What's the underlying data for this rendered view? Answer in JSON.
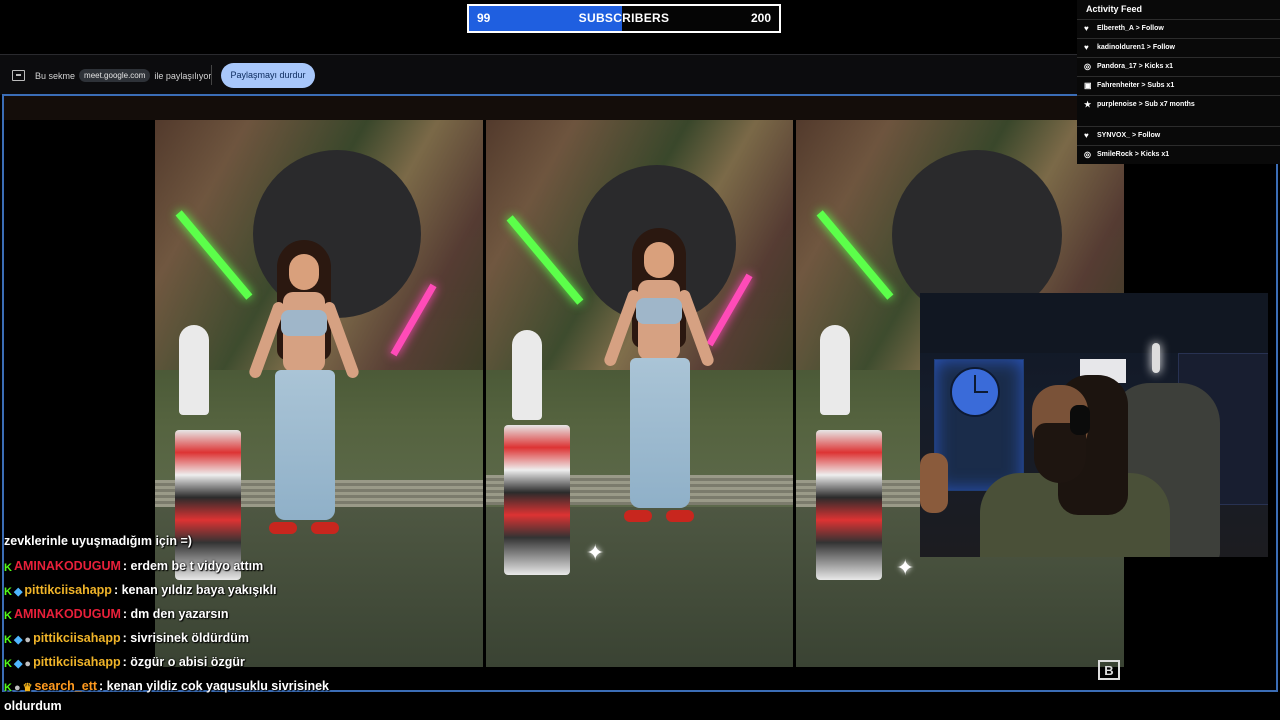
{
  "subscriber_goal": {
    "current": "99",
    "label": "SUBSCRIBERS",
    "target": "200",
    "progress": 0.495,
    "fill_color": "#1f5fe0"
  },
  "share_bar": {
    "prefix": "Bu sekme",
    "domain": "meet.google.com",
    "suffix": "ile paylaşılıyor",
    "stop_button": "Paylaşmayı durdur",
    "icon": "screen-share-icon"
  },
  "activity_feed": {
    "title": "Activity Feed",
    "items": [
      {
        "icon": "heart-icon",
        "text": "Elbereth_A > Follow"
      },
      {
        "icon": "heart-icon",
        "text": "kadinolduren1 > Follow"
      },
      {
        "icon": "kicks-icon",
        "text": "Pandora_17 > Kicks x1"
      },
      {
        "icon": "gift-icon",
        "text": "Fahrenheiter > Subs x1"
      },
      {
        "icon": "star-icon",
        "text": "purplenoise > Sub x7 months"
      },
      {
        "icon": "heart-icon",
        "text": "SYNVOX_ > Follow"
      },
      {
        "icon": "kicks-icon",
        "text": "SmileRock > Kicks x1"
      }
    ]
  },
  "chat": {
    "wrapped_text": "zevklerinle uyuşmadığım için =)",
    "messages": [
      {
        "user": "AMINAKODUGUM",
        "user_color": "#e8203a",
        "text": ": erdem be t vidyo attım",
        "badges": [
          "kick-icon"
        ]
      },
      {
        "user": "pittikciisahapp",
        "user_color": "#f0b429",
        "text": ": kenan yıldız baya yakışıklı",
        "badges": [
          "kick-icon",
          "gem-icon"
        ]
      },
      {
        "user": "AMINAKODUGUM",
        "user_color": "#e8203a",
        "text": ": dm den yazarsın",
        "badges": [
          "kick-icon"
        ]
      },
      {
        "user": "pittikciisahapp",
        "user_color": "#f0b429",
        "text": ": sivrisinek öldürdüm",
        "badges": [
          "kick-icon",
          "gem-icon",
          "coin-icon"
        ]
      },
      {
        "user": "pittikciisahapp",
        "user_color": "#f0b429",
        "text": ": özgür o abisi özgür",
        "badges": [
          "kick-icon",
          "gem-icon",
          "coin-icon"
        ]
      },
      {
        "user": "search_ett",
        "user_color": "#ff9a1f",
        "text": ": kenan yildiz cok yaqusuklu sivrisinek",
        "badges": [
          "kick-icon",
          "coin-icon",
          "crown-icon"
        ]
      }
    ],
    "last_wrap": "oldurdum"
  }
}
